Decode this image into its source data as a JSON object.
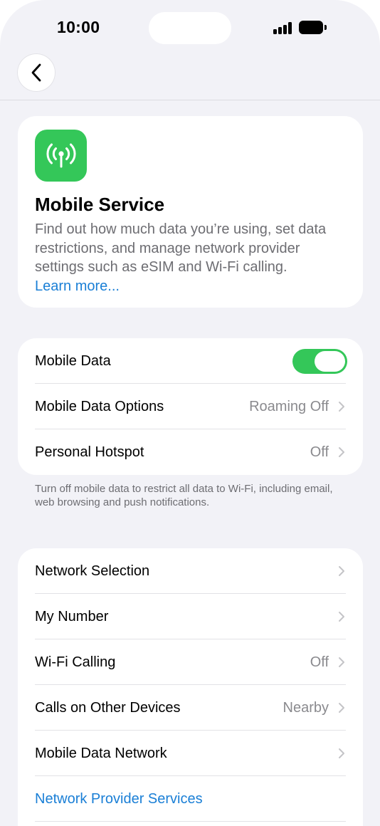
{
  "status_bar": {
    "time": "10:00"
  },
  "hero": {
    "title": "Mobile Service",
    "description": "Find out how much data you’re using, set data restrictions, and manage network provider settings such as eSIM and Wi-Fi calling.",
    "learn_more": "Learn more..."
  },
  "data_section": {
    "mobile_data": {
      "label": "Mobile Data",
      "enabled": true
    },
    "mobile_data_options": {
      "label": "Mobile Data Options",
      "value": "Roaming Off"
    },
    "personal_hotspot": {
      "label": "Personal Hotspot",
      "value": "Off"
    },
    "footnote": "Turn off mobile data to restrict all data to Wi-Fi, including email, web browsing and push notifications."
  },
  "network_section": {
    "items": [
      {
        "label": "Network Selection",
        "value": ""
      },
      {
        "label": "My Number",
        "value": ""
      },
      {
        "label": "Wi-Fi Calling",
        "value": "Off"
      },
      {
        "label": "Calls on Other Devices",
        "value": "Nearby"
      },
      {
        "label": "Mobile Data Network",
        "value": ""
      },
      {
        "label": "Network Provider Services",
        "value": ""
      }
    ]
  },
  "colors": {
    "accent_green": "#34c759",
    "link_blue": "#1a7fd6",
    "background": "#f2f2f7"
  }
}
